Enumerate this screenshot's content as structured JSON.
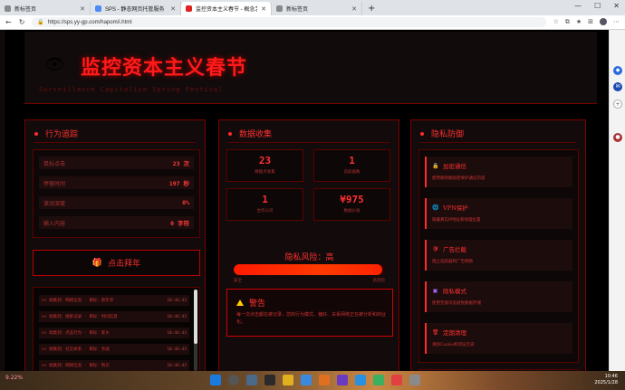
{
  "browser": {
    "tabs": [
      {
        "title": "新标签页",
        "active": false
      },
      {
        "title": "SPS - 静态网页托管服务",
        "active": false
      },
      {
        "title": "监控资本主义春节 - 概念艺术",
        "active": true
      },
      {
        "title": "新标签页",
        "active": false
      }
    ],
    "new_tab": "+",
    "url": "https://sps.yy-gp.com/hapom/i.html"
  },
  "header": {
    "eye_icon": "eye-icon",
    "title": "监控资本主义春节",
    "subtitle": "Surveillance Capitalism Spring Festival"
  },
  "tracking": {
    "title": "行为追踪",
    "metrics": [
      {
        "label": "鼠标点击",
        "value": "23 次"
      },
      {
        "label": "停留时间",
        "value": "197 秒"
      },
      {
        "label": "滚动深度",
        "value": "0%"
      },
      {
        "label": "输入内容",
        "value": "0 字符"
      }
    ],
    "click_button": "点击拜年",
    "log": [
      {
        "text": ">> 收集到：网络信息 · 目标：新年享",
        "time": "10:46:43"
      },
      {
        "text": ">> 收集到：搜索记录 · 目标：时间信息",
        "time": "10:46:43"
      },
      {
        "text": ">> 收集到：点击行为 · 目标：家乡",
        "time": "10:46:43"
      },
      {
        "text": ">> 收集到：社交关系 · 目标：亲戚",
        "time": "10:46:43"
      },
      {
        "text": ">> 收集到：网络信息 · 目标：购买",
        "time": "10:46:43"
      }
    ]
  },
  "collection": {
    "title": "数据收集",
    "stats": [
      {
        "value": "23",
        "label": "数据点收集"
      },
      {
        "value": "1",
        "label": "追踪器数"
      },
      {
        "value": "1",
        "label": "合作公司"
      },
      {
        "value": "¥975",
        "label": "数据价值"
      }
    ],
    "risk_label": "隐私风险：高",
    "risk_level": 0.98,
    "risk_low": "安全",
    "risk_high": "高风险",
    "warning_title": "警告",
    "warning_body": "每一次点击都在被记录，您的行为模式、偏好、关系网络正在被分析和商业化。"
  },
  "privacy": {
    "title": "隐私防御",
    "tips": [
      {
        "icon": "lock-icon",
        "glyph": "🔒",
        "title": "加密通信",
        "desc": "使用端到端加密保护通信内容"
      },
      {
        "icon": "globe-icon",
        "glyph": "🌐",
        "title": "VPN保护",
        "desc": "隐藏真实IP地址和地理位置"
      },
      {
        "icon": "shield-icon",
        "glyph": "🛡",
        "title": "广告拦截",
        "desc": "阻止追踪器和广告网络"
      },
      {
        "icon": "incognito-icon",
        "glyph": "▣",
        "title": "隐私模式",
        "desc": "使用无痕浏览避免数据存储"
      },
      {
        "icon": "trash-icon",
        "glyph": "🗑",
        "title": "定期清理",
        "desc": "清除Cookie和浏览历史"
      }
    ]
  },
  "taskbar": {
    "left": "9.22%",
    "time": "10:46",
    "date": "2025/1/28"
  }
}
